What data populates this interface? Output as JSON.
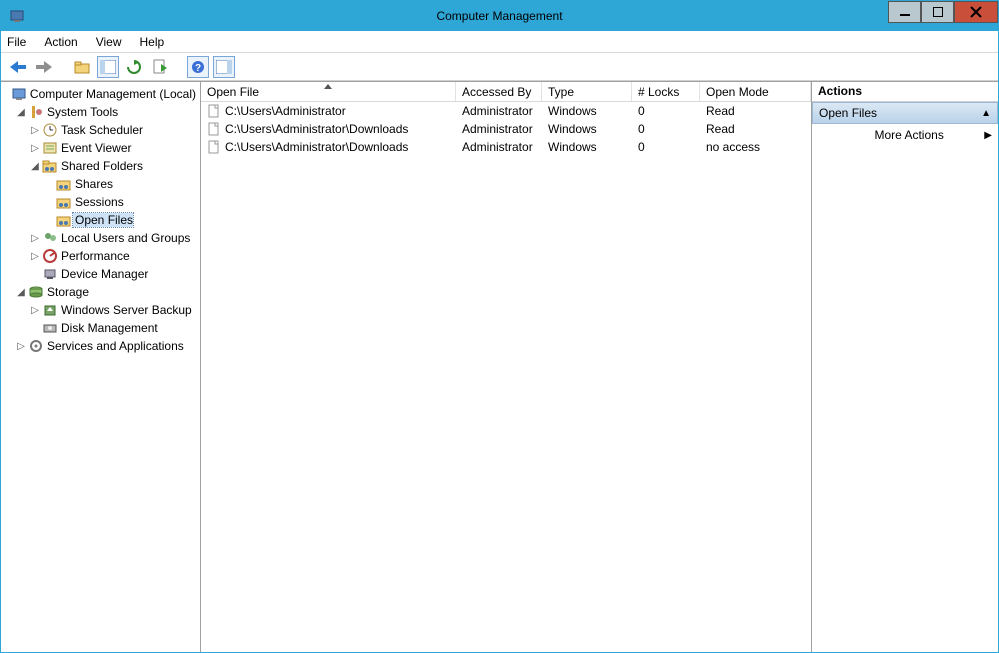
{
  "window": {
    "title": "Computer Management"
  },
  "menu": {
    "file": "File",
    "action": "Action",
    "view": "View",
    "help": "Help"
  },
  "tree": {
    "root": "Computer Management (Local)",
    "system_tools": "System Tools",
    "task_scheduler": "Task Scheduler",
    "event_viewer": "Event Viewer",
    "shared_folders": "Shared Folders",
    "shares": "Shares",
    "sessions": "Sessions",
    "open_files": "Open Files",
    "local_users": "Local Users and Groups",
    "performance": "Performance",
    "device_manager": "Device Manager",
    "storage": "Storage",
    "wsb": "Windows Server Backup",
    "disk_mgmt": "Disk Management",
    "services_apps": "Services and Applications"
  },
  "columns": {
    "c0": "Open File",
    "c1": "Accessed By",
    "c2": "Type",
    "c3": "# Locks",
    "c4": "Open Mode"
  },
  "rows": [
    {
      "file": "C:\\Users\\Administrator",
      "by": "Administrator",
      "type": "Windows",
      "locks": "0",
      "mode": "Read"
    },
    {
      "file": "C:\\Users\\Administrator\\Downloads",
      "by": "Administrator",
      "type": "Windows",
      "locks": "0",
      "mode": "Read"
    },
    {
      "file": "C:\\Users\\Administrator\\Downloads",
      "by": "Administrator",
      "type": "Windows",
      "locks": "0",
      "mode": "no access"
    }
  ],
  "actions": {
    "header": "Actions",
    "section": "Open Files",
    "more": "More Actions"
  }
}
